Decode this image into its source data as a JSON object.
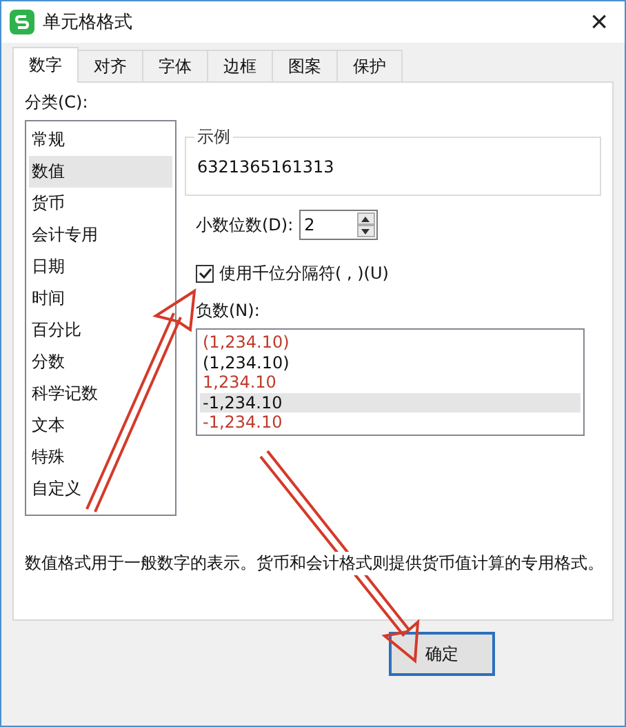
{
  "window": {
    "title": "单元格格式",
    "close": "×"
  },
  "tabs": [
    {
      "label": "数字",
      "selected": true
    },
    {
      "label": "对齐",
      "selected": false
    },
    {
      "label": "字体",
      "selected": false
    },
    {
      "label": "边框",
      "selected": false
    },
    {
      "label": "图案",
      "selected": false
    },
    {
      "label": "保护",
      "selected": false
    }
  ],
  "category": {
    "label": "分类(C):",
    "items": [
      {
        "label": "常规",
        "selected": false
      },
      {
        "label": "数值",
        "selected": true
      },
      {
        "label": "货币",
        "selected": false
      },
      {
        "label": "会计专用",
        "selected": false
      },
      {
        "label": "日期",
        "selected": false
      },
      {
        "label": "时间",
        "selected": false
      },
      {
        "label": "百分比",
        "selected": false
      },
      {
        "label": "分数",
        "selected": false
      },
      {
        "label": "科学记数",
        "selected": false
      },
      {
        "label": "文本",
        "selected": false
      },
      {
        "label": "特殊",
        "selected": false
      },
      {
        "label": "自定义",
        "selected": false
      }
    ]
  },
  "sample": {
    "label": "示例",
    "value": "6321365161313"
  },
  "decimal_places": {
    "label": "小数位数(D):",
    "value": "2"
  },
  "thousands_separator": {
    "label": "使用千位分隔符( , )(U)",
    "checked": true
  },
  "negative_numbers": {
    "label": "负数(N):",
    "items": [
      {
        "label": "(1,234.10)",
        "color": "#c0392b",
        "selected": false
      },
      {
        "label": "(1,234.10)",
        "color": "#111111",
        "selected": false
      },
      {
        "label": "1,234.10",
        "color": "#c0392b",
        "selected": false
      },
      {
        "label": "-1,234.10",
        "color": "#111111",
        "selected": true
      },
      {
        "label": "-1,234.10",
        "color": "#c0392b",
        "selected": false
      }
    ]
  },
  "description": "数值格式用于一般数字的表示。货币和会计格式则提供货币值计算的专用格式。",
  "buttons": [
    {
      "label": "确定"
    }
  ]
}
